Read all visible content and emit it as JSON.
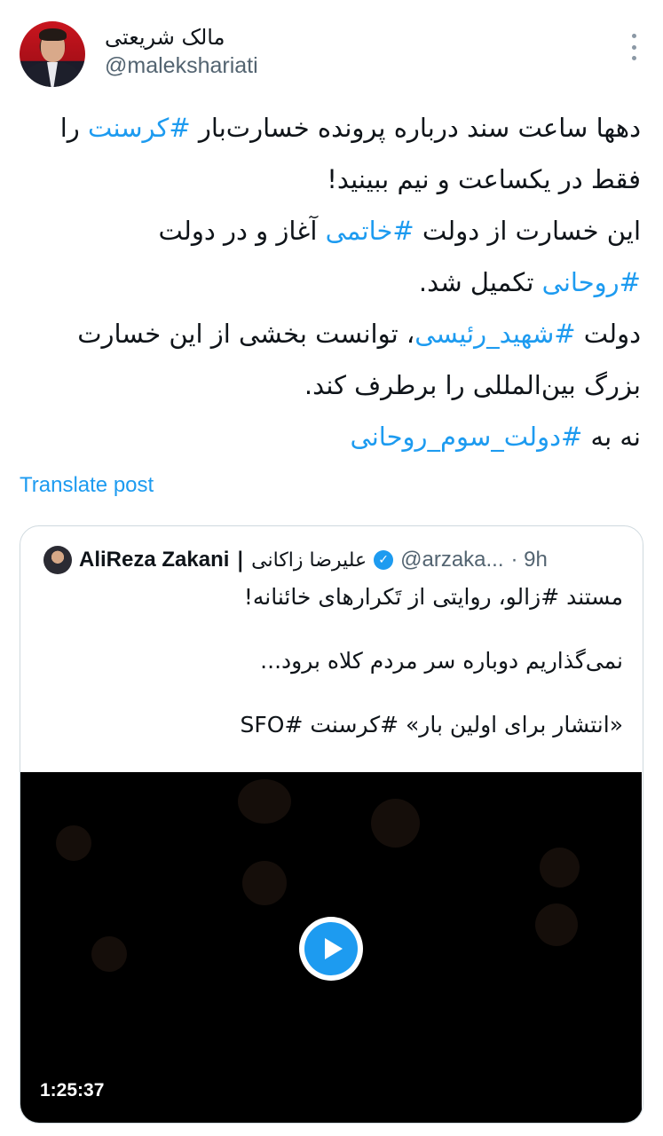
{
  "author": {
    "display_name": "مالک شریعتی",
    "handle": "@malekshariati"
  },
  "tweet": {
    "lines": [
      [
        {
          "t": "دهها ساعت سند درباره پرونده خسارت‌بار "
        },
        {
          "t": "#کرسنت",
          "tag": true
        },
        {
          "t": " را"
        }
      ],
      [
        {
          "t": "فقط در یکساعت و نیم ببینید!"
        }
      ],
      [
        {
          "t": "این خسارت از دولت "
        },
        {
          "t": "#خاتمی",
          "tag": true
        },
        {
          "t": " آغاز و در دولت"
        }
      ],
      [
        {
          "t": "#روحانی",
          "tag": true
        },
        {
          "t": " تکمیل شد."
        }
      ],
      [
        {
          "t": "دولت "
        },
        {
          "t": "#شهید_رئیسی",
          "tag": true
        },
        {
          "t": "، توانست بخشی از این خسارت"
        }
      ],
      [
        {
          "t": "بزرگ بین‌المللی را برطرف کند."
        }
      ],
      [
        {
          "t": "نه به "
        },
        {
          "t": "#دولت_سوم_روحانی",
          "tag": true
        }
      ]
    ]
  },
  "translate_label": "Translate post",
  "quote": {
    "name": "AliReza Zakani",
    "separator": "|",
    "name_fa": "علیرضا زاکانی",
    "handle": "@arzaka...",
    "time": "· 9h",
    "paragraphs": [
      "مستند #زالو، روایتی از تَکرارهای خائنانه!",
      "",
      "نمی‌گذاریم دوباره سر مردم کلاه برود...",
      "",
      "«انتشار برای اولین بار» #کرسنت #SFO"
    ],
    "video": {
      "duration": "1:25:37"
    }
  },
  "colors": {
    "link": "#1d9bf0",
    "secondary_text": "#536471",
    "border": "#cfd9de"
  }
}
